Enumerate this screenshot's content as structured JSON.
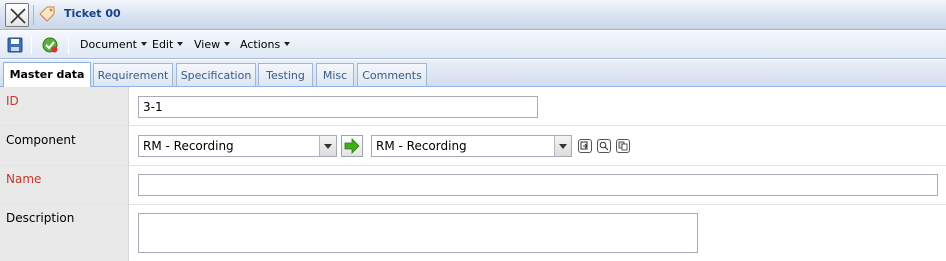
{
  "window": {
    "title": "Ticket 00"
  },
  "toolbar": {
    "menus": [
      "Document",
      "Edit",
      "View",
      "Actions"
    ]
  },
  "tabs": [
    {
      "label": "Master data",
      "active": true
    },
    {
      "label": "Requirement",
      "active": false
    },
    {
      "label": "Specification",
      "active": false
    },
    {
      "label": "Testing",
      "active": false
    },
    {
      "label": "Misc",
      "active": false
    },
    {
      "label": "Comments",
      "active": false
    }
  ],
  "form": {
    "id": {
      "label": "ID",
      "value": "3-1"
    },
    "component": {
      "label": "Component",
      "select_left": "RM - Recording",
      "select_right": "RM - Recording"
    },
    "name": {
      "label": "Name",
      "value": ""
    },
    "description": {
      "label": "Description",
      "value": ""
    }
  },
  "colors": {
    "required_label": "#c0392b",
    "title": "#15428b",
    "label_column_bg": "#e9e9e9",
    "go_arrow": "#3fae1d"
  },
  "icons": [
    "close-icon",
    "tag-icon",
    "save-icon",
    "check-icon",
    "dropdown-arrow-icon",
    "arrow-right-icon",
    "copy-icon",
    "search-icon",
    "clipboard-icon"
  ]
}
